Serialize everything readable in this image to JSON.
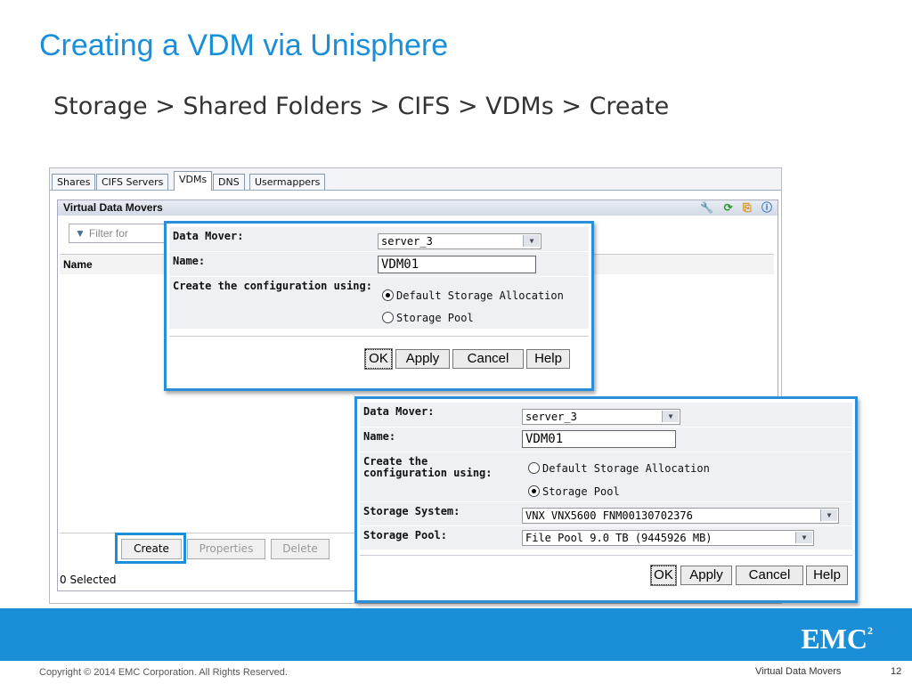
{
  "slide": {
    "title": "Creating a VDM via Unisphere",
    "subtitle": "Storage > Shared Folders > CIFS > VDMs > Create"
  },
  "tabs": [
    {
      "label": "Shares",
      "active": false
    },
    {
      "label": "CIFS Servers",
      "active": false
    },
    {
      "label": "VDMs",
      "active": true
    },
    {
      "label": "DNS",
      "active": false
    },
    {
      "label": "Usermappers",
      "active": false
    }
  ],
  "panel": {
    "title": "Virtual Data Movers",
    "header_icons": [
      "wrench-icon",
      "refresh-icon",
      "export-icon",
      "help-icon"
    ],
    "filter_placeholder": "Filter for",
    "column_name": "Name",
    "selected_count": "0 Selected",
    "buttons": {
      "create": "Create",
      "properties": "Properties",
      "delete": "Delete"
    }
  },
  "dialog1": {
    "data_mover_label": "Data Mover:",
    "data_mover_value": "server_3",
    "name_label": "Name:",
    "name_value": "VDM01",
    "config_label": "Create the configuration using:",
    "option_default": "Default Storage Allocation",
    "option_pool": "Storage Pool",
    "selected_option": "default",
    "buttons": {
      "ok": "OK",
      "apply": "Apply",
      "cancel": "Cancel",
      "help": "Help"
    }
  },
  "dialog2": {
    "data_mover_label": "Data Mover:",
    "data_mover_value": "server_3",
    "name_label": "Name:",
    "name_value": "VDM01",
    "config_label_1": "Create the",
    "config_label_2": "configuration using:",
    "option_default": "Default Storage Allocation",
    "option_pool": "Storage Pool",
    "selected_option": "pool",
    "storage_system_label": "Storage System:",
    "storage_system_value": "VNX VNX5600 FNM00130702376",
    "storage_pool_label": "Storage Pool:",
    "storage_pool_value": "File Pool 9.0 TB (9445926 MB)",
    "buttons": {
      "ok": "OK",
      "apply": "Apply",
      "cancel": "Cancel",
      "help": "Help"
    }
  },
  "footer": {
    "logo": "EMC",
    "logo_sup": "2",
    "copyright": "Copyright © 2014 EMC Corporation. All Rights Reserved.",
    "section": "Virtual Data Movers",
    "page": "12"
  },
  "colors": {
    "accent": "#1a8fd8"
  }
}
